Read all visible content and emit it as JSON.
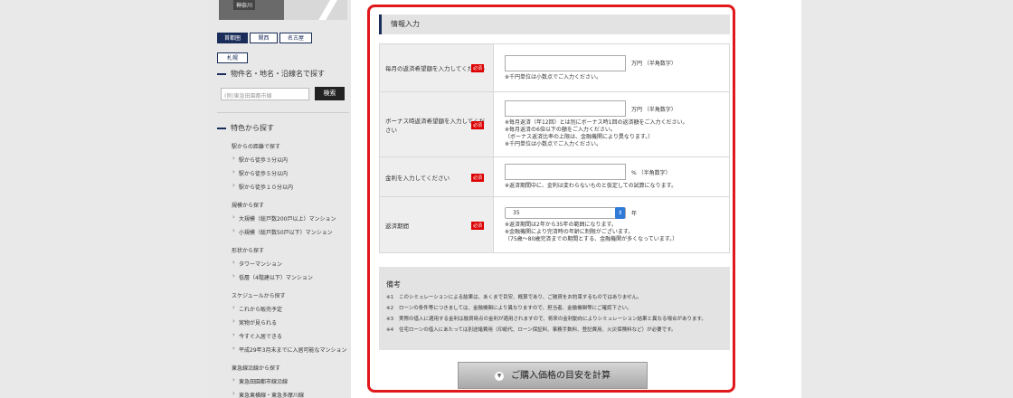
{
  "sidebar": {
    "map_label": "神奈川",
    "regions": [
      "首都圏",
      "関西",
      "名古屋",
      "札幌"
    ],
    "search_heading": "物件名・地名・沿線名で探す",
    "search_placeholder": "(例)東急田園都市線",
    "search_button": "検索",
    "feature_heading": "特色から探す",
    "groups": [
      {
        "title": "駅からの距離で探す",
        "items": [
          "駅から徒歩３分以内",
          "駅から徒歩５分以内",
          "駅から徒歩１０分以内"
        ]
      },
      {
        "title": "規模から探す",
        "items": [
          "大規模（総戸数200戸以上）マンション",
          "小規模（総戸数50戸以下）マンション"
        ]
      },
      {
        "title": "形状から探す",
        "items": [
          "タワーマンション",
          "低層（4階建以下）マンション"
        ]
      },
      {
        "title": "スケジュールから探す",
        "items": [
          "これから販売予定",
          "実物が見られる",
          "今すぐ入居できる",
          "平成29年3月末までに入居可能なマンション"
        ]
      },
      {
        "title": "東急線沿線から探す",
        "items": [
          "東急田園都市線沿線",
          "東急東横線・東急多摩川線"
        ]
      }
    ]
  },
  "form": {
    "section_title": "情報入力",
    "required_badge": "必須",
    "rows": [
      {
        "label": "毎月の返済希望額を入力してください",
        "unit": "万円 （半角数字）",
        "notes": [
          "※千円単位は小数点でご入力ください。"
        ]
      },
      {
        "label": "ボーナス時返済希望額を入力してください",
        "unit": "万円 （半角数字）",
        "notes": [
          "※毎月返済（年12回）とは別にボーナス時1回の返済額をご入力ください。",
          "※毎月返済の6倍以下の額をご入力ください。",
          "（ボーナス返済比率の上限は、金融機関により異なります。）",
          "※千円単位は小数点でご入力ください。"
        ]
      },
      {
        "label": "金利を入力してください",
        "unit": "% （半角数字）",
        "notes": [
          "※返済期間中に、金利は変わらないものと仮定しての試算になります。"
        ]
      },
      {
        "label": "返済期間",
        "unit": "年",
        "select_value": "35",
        "notes": [
          "※返済期間は2年から35年の範囲になります。",
          "※金融機関により完済時の年齢に制限がございます。",
          "（75歳～80歳完済までの期間とする、金融機関が多くなっています。）"
        ]
      }
    ],
    "remarks_title": "備考",
    "remarks": [
      {
        "num": "※1",
        "text": "このシミュレーションによる結果は、あくまで目安、概算であり、ご融資をお約束するものではありません。"
      },
      {
        "num": "※2",
        "text": "ローンの条件等につきましては、金融機関により異なりますので、担当者、金融機関等にご確認下さい。"
      },
      {
        "num": "※3",
        "text": "実際の借入に適用する金利は融資時点の金利が適用されますので、将来の金利動向によりシミュレーション結果と異なる場合があります。"
      },
      {
        "num": "※4",
        "text": "住宅ローンの借入にあたっては別途諸費用（印紙代、ローン保証料、事務手数料、登記費用、火災保険料など）が必要です。"
      }
    ],
    "calc_button": "ご購入価格の目安を計算",
    "calc_icon": "chevron-down-circle-icon"
  }
}
